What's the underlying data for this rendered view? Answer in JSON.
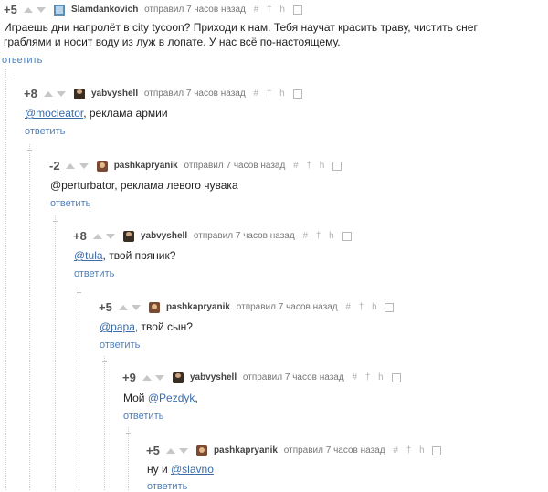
{
  "comments": [
    {
      "rating": "+5",
      "author": "Slamdankovich",
      "meta": "отправил 7 часов назад",
      "tools": [
        "#",
        "†",
        "h"
      ],
      "text_lines": [
        "Играешь дни напролёт в city tycoon? Приходи к нам. Тебя научат красить траву, чистить снег",
        "граблями и носит воду из луж в лопате. У нас всё по-настоящему."
      ],
      "reply": "ответить"
    },
    {
      "rating": "+8",
      "author": "yabvyshell",
      "meta": "отправил 7 часов назад",
      "tools": [
        "#",
        "†",
        "h"
      ],
      "mention": "@mocleator",
      "text_after": ", реклама армии",
      "reply": "ответить"
    },
    {
      "rating": "-2",
      "author": "pashkapryanik",
      "meta": "отправил 7 часов назад",
      "tools": [
        "#",
        "†",
        "h"
      ],
      "text": "@perturbator, реклама левого чувака",
      "reply": "ответить"
    },
    {
      "rating": "+8",
      "author": "yabvyshell",
      "meta": "отправил 7 часов назад",
      "tools": [
        "#",
        "†",
        "h"
      ],
      "mention": "@tula",
      "text_after": ", твой пряник?",
      "reply": "ответить"
    },
    {
      "rating": "+5",
      "author": "pashkapryanik",
      "meta": "отправил 7 часов назад",
      "tools": [
        "#",
        "†",
        "h"
      ],
      "mention": "@papa",
      "text_after": ", твой сын?",
      "reply": "ответить"
    },
    {
      "rating": "+9",
      "author": "yabvyshell",
      "meta": "отправил 7 часов назад",
      "tools": [
        "#",
        "†",
        "h"
      ],
      "text_before": "Мой ",
      "mention": "@Pezdyk",
      "text_after": ",",
      "reply": "ответить"
    },
    {
      "rating": "+5",
      "author": "pashkapryanik",
      "meta": "отправил 7 часов назад",
      "tools": [
        "#",
        "†",
        "h"
      ],
      "text_before": "ну и ",
      "mention": "@slavno",
      "reply": "ответить"
    }
  ]
}
